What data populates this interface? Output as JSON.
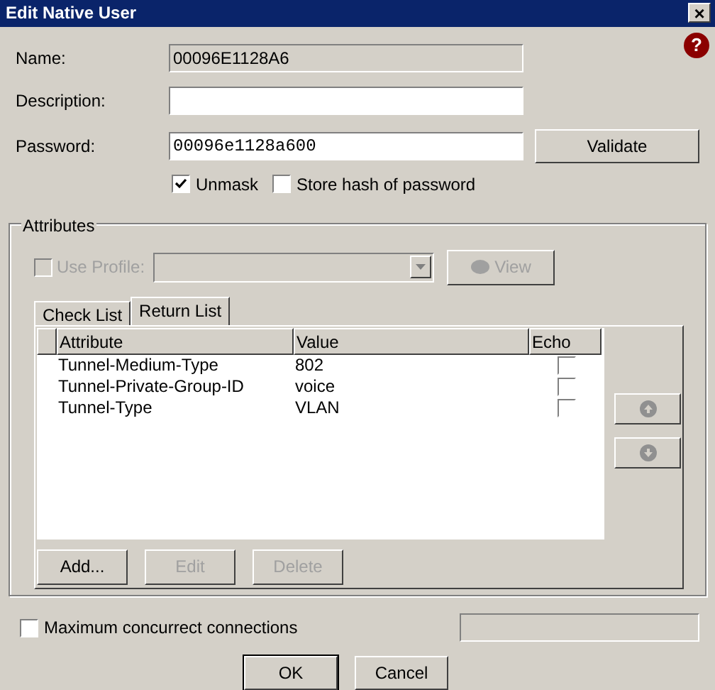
{
  "window": {
    "title": "Edit Native User",
    "close": "×",
    "help": "?"
  },
  "fields": [
    {
      "label": "Name:",
      "value": "00096E1128A6",
      "disabled": true
    },
    {
      "label": "Description:",
      "disabled": false
    },
    {
      "label": "Password:",
      "value": "00096e1128a600",
      "disabled": false
    }
  ],
  "validate_button": {
    "label": "Validate",
    "disabled": false
  },
  "options": [
    {
      "label": "Unmask",
      "checked": true
    },
    {
      "label": "Store hash of password",
      "checked": false
    }
  ],
  "attributes": {
    "title": "Attributes",
    "use_profile": {
      "label": "Use Profile:",
      "checked": false,
      "disabled": true
    },
    "view_button": {
      "label": "View",
      "disabled": true
    },
    "tabs": [
      {
        "label": "Check List",
        "selected": false
      },
      {
        "label": "Return List",
        "selected": true
      }
    ],
    "table": {
      "columns": [
        "Attribute",
        "Value",
        "Echo"
      ],
      "rows": [
        {
          "attribute": "Tunnel-Medium-Type",
          "value": "802",
          "echo": false
        },
        {
          "attribute": "Tunnel-Private-Group-ID",
          "value": "voice",
          "echo": false
        },
        {
          "attribute": "Tunnel-Type",
          "value": "VLAN",
          "echo": false
        }
      ]
    },
    "move_buttons": [
      {
        "kind": "up",
        "disabled": true
      },
      {
        "kind": "down",
        "disabled": true
      }
    ],
    "buttons": [
      {
        "label": "Add...",
        "disabled": false
      },
      {
        "label": "Edit",
        "disabled": true
      },
      {
        "label": "Delete",
        "disabled": true
      }
    ]
  },
  "max_connections": {
    "label": "Maximum concurrect connections",
    "checked": false,
    "disabled": true
  },
  "buttons": [
    {
      "label": "OK"
    },
    {
      "label": "Cancel"
    }
  ]
}
